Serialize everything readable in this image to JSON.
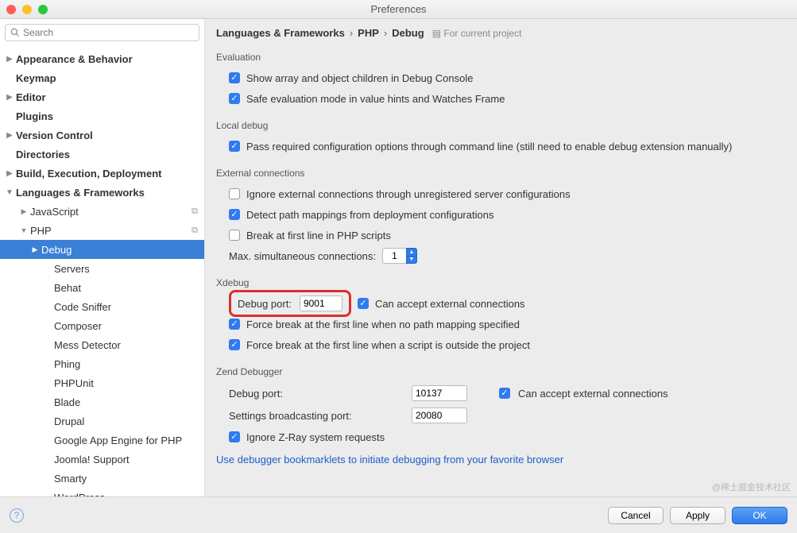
{
  "window": {
    "title": "Preferences"
  },
  "search": {
    "placeholder": "Search"
  },
  "sidebar": {
    "items": [
      {
        "label": "Appearance & Behavior",
        "bold": true,
        "arrow": "right",
        "pad": 0
      },
      {
        "label": "Keymap",
        "bold": true,
        "pad": 0
      },
      {
        "label": "Editor",
        "bold": true,
        "arrow": "right",
        "pad": 0
      },
      {
        "label": "Plugins",
        "bold": true,
        "pad": 0
      },
      {
        "label": "Version Control",
        "bold": true,
        "arrow": "right",
        "pad": 0
      },
      {
        "label": "Directories",
        "bold": true,
        "pad": 0
      },
      {
        "label": "Build, Execution, Deployment",
        "bold": true,
        "arrow": "right",
        "pad": 0
      },
      {
        "label": "Languages & Frameworks",
        "bold": true,
        "arrow": "down",
        "pad": 0
      },
      {
        "label": "JavaScript",
        "pad": 1,
        "arrow2": "right",
        "dup": true
      },
      {
        "label": "PHP",
        "pad": 1,
        "arrow2": "down",
        "dup": true
      },
      {
        "label": "Debug",
        "pad": 2,
        "arrow2": "right",
        "selected": true
      },
      {
        "label": "Servers",
        "pad": 3
      },
      {
        "label": "Behat",
        "pad": 3
      },
      {
        "label": "Code Sniffer",
        "pad": 3
      },
      {
        "label": "Composer",
        "pad": 3
      },
      {
        "label": "Mess Detector",
        "pad": 3
      },
      {
        "label": "Phing",
        "pad": 3
      },
      {
        "label": "PHPUnit",
        "pad": 3
      },
      {
        "label": "Blade",
        "pad": 3
      },
      {
        "label": "Drupal",
        "pad": 3
      },
      {
        "label": "Google App Engine for PHP",
        "pad": 3
      },
      {
        "label": "Joomla! Support",
        "pad": 3
      },
      {
        "label": "Smarty",
        "pad": 3
      },
      {
        "label": "WordPress",
        "pad": 3
      }
    ]
  },
  "breadcrumb": {
    "p1": "Languages & Frameworks",
    "p2": "PHP",
    "p3": "Debug",
    "hint": "For current project"
  },
  "sections": {
    "evaluation": {
      "title": "Evaluation",
      "opt1": "Show array and object children in Debug Console",
      "opt2": "Safe evaluation mode in value hints and Watches Frame"
    },
    "local": {
      "title": "Local debug",
      "opt1": "Pass required configuration options through command line (still need to enable debug extension manually)"
    },
    "external": {
      "title": "External connections",
      "opt1": "Ignore external connections through unregistered server configurations",
      "opt2": "Detect path mappings from deployment configurations",
      "opt3": "Break at first line in PHP scripts",
      "maxlabel": "Max. simultaneous connections:",
      "maxval": "1"
    },
    "xdebug": {
      "title": "Xdebug",
      "portlabel": "Debug port:",
      "port": "9001",
      "accept": "Can accept external connections",
      "force1": "Force break at the first line when no path mapping specified",
      "force2": "Force break at the first line when a script is outside the project"
    },
    "zend": {
      "title": "Zend Debugger",
      "portlabel": "Debug port:",
      "port": "10137",
      "accept": "Can accept external connections",
      "bcastlabel": "Settings broadcasting port:",
      "bcast": "20080",
      "zray": "Ignore Z-Ray system requests"
    },
    "link": "Use debugger bookmarklets to initiate debugging from your favorite browser"
  },
  "footer": {
    "cancel": "Cancel",
    "apply": "Apply",
    "ok": "OK"
  },
  "watermark": "@稀土掘金技术社区"
}
